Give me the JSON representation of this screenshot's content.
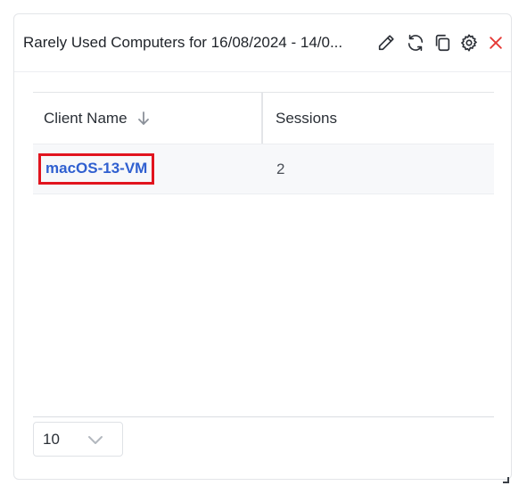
{
  "widget": {
    "title": "Rarely Used Computers for 16/08/2024 - 14/0...",
    "tools": [
      "edit-icon",
      "refresh-icon",
      "copy-icon",
      "settings-icon",
      "close-icon"
    ],
    "close_color": "#e53935"
  },
  "table": {
    "columns": [
      {
        "label": "Client Name",
        "sort": "descending"
      },
      {
        "label": "Sessions"
      }
    ],
    "rows": [
      {
        "client_name": "macOS-13-VM",
        "sessions": "2"
      }
    ]
  },
  "pagination": {
    "page_size": "10"
  },
  "colors": {
    "link": "#2f5fd0",
    "highlight_border": "#e1141e",
    "row_background": "#f7f8fa"
  }
}
